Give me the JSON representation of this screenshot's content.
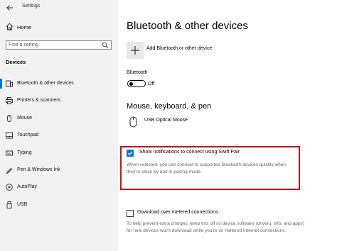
{
  "window": {
    "title": "Settings"
  },
  "sidebar": {
    "home_label": "Home",
    "search_placeholder": "Find a setting",
    "section_title": "Devices",
    "items": [
      {
        "label": "Bluetooth & other devices",
        "icon": "bluetooth-devices-icon",
        "active": true
      },
      {
        "label": "Printers & scanners",
        "icon": "printer-icon",
        "active": false
      },
      {
        "label": "Mouse",
        "icon": "mouse-icon",
        "active": false
      },
      {
        "label": "Touchpad",
        "icon": "touchpad-icon",
        "active": false
      },
      {
        "label": "Typing",
        "icon": "keyboard-icon",
        "active": false
      },
      {
        "label": "Pen & Windows Ink",
        "icon": "pen-icon",
        "active": false
      },
      {
        "label": "AutoPlay",
        "icon": "autoplay-icon",
        "active": false
      },
      {
        "label": "USB",
        "icon": "usb-icon",
        "active": false
      }
    ]
  },
  "main": {
    "title": "Bluetooth & other devices",
    "add_device_label": "Add Bluetooth or other device",
    "bluetooth_label": "Bluetooth",
    "bluetooth_state": "Off",
    "peripherals_heading": "Mouse, keyboard, & pen",
    "device_name": "USB Optical Mouse",
    "swift_pair": {
      "checked": true,
      "label": "Show notifications to connect using Swift Pair",
      "description": "When selected, you can connect to supported Bluetooth devices quickly when they're close by and in pairing mode."
    },
    "metered": {
      "checked": false,
      "label": "Download over metered connections",
      "description": "To help prevent extra charges, keep this off so device software (drivers, info, and apps) for new devices won't download while you're on metered Internet connections."
    }
  },
  "colors": {
    "accent": "#0078d7",
    "highlight_border": "#c4161c",
    "sidebar_bg": "#f2f2f2"
  }
}
